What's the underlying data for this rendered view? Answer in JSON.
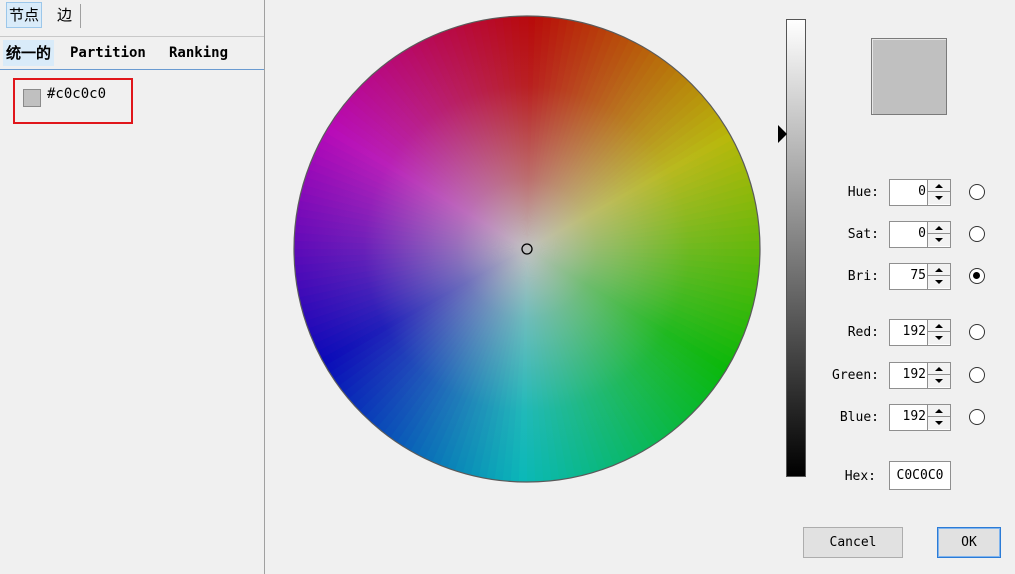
{
  "left_panel": {
    "tabs": [
      "节点",
      "边"
    ],
    "sub_tabs": [
      "统一的",
      "Partition",
      "Ranking"
    ],
    "color_item": {
      "label": "#c0c0c0",
      "swatch_color": "#c0c0c0"
    }
  },
  "color_picker": {
    "preview_color": "#c0c0c0",
    "fields": [
      {
        "label": "Hue:",
        "value": "0",
        "selected": false
      },
      {
        "label": "Sat:",
        "value": "0",
        "selected": false
      },
      {
        "label": "Bri:",
        "value": "75",
        "selected": true
      },
      {
        "label": "Red:",
        "value": "192",
        "selected": false
      },
      {
        "label": "Green:",
        "value": "192",
        "selected": false
      },
      {
        "label": "Blue:",
        "value": "192",
        "selected": false
      }
    ],
    "hex": {
      "label": "Hex:",
      "value": "C0C0C0"
    },
    "brightness_level": 0.75,
    "cancel_label": "Cancel",
    "ok_label": "OK"
  }
}
